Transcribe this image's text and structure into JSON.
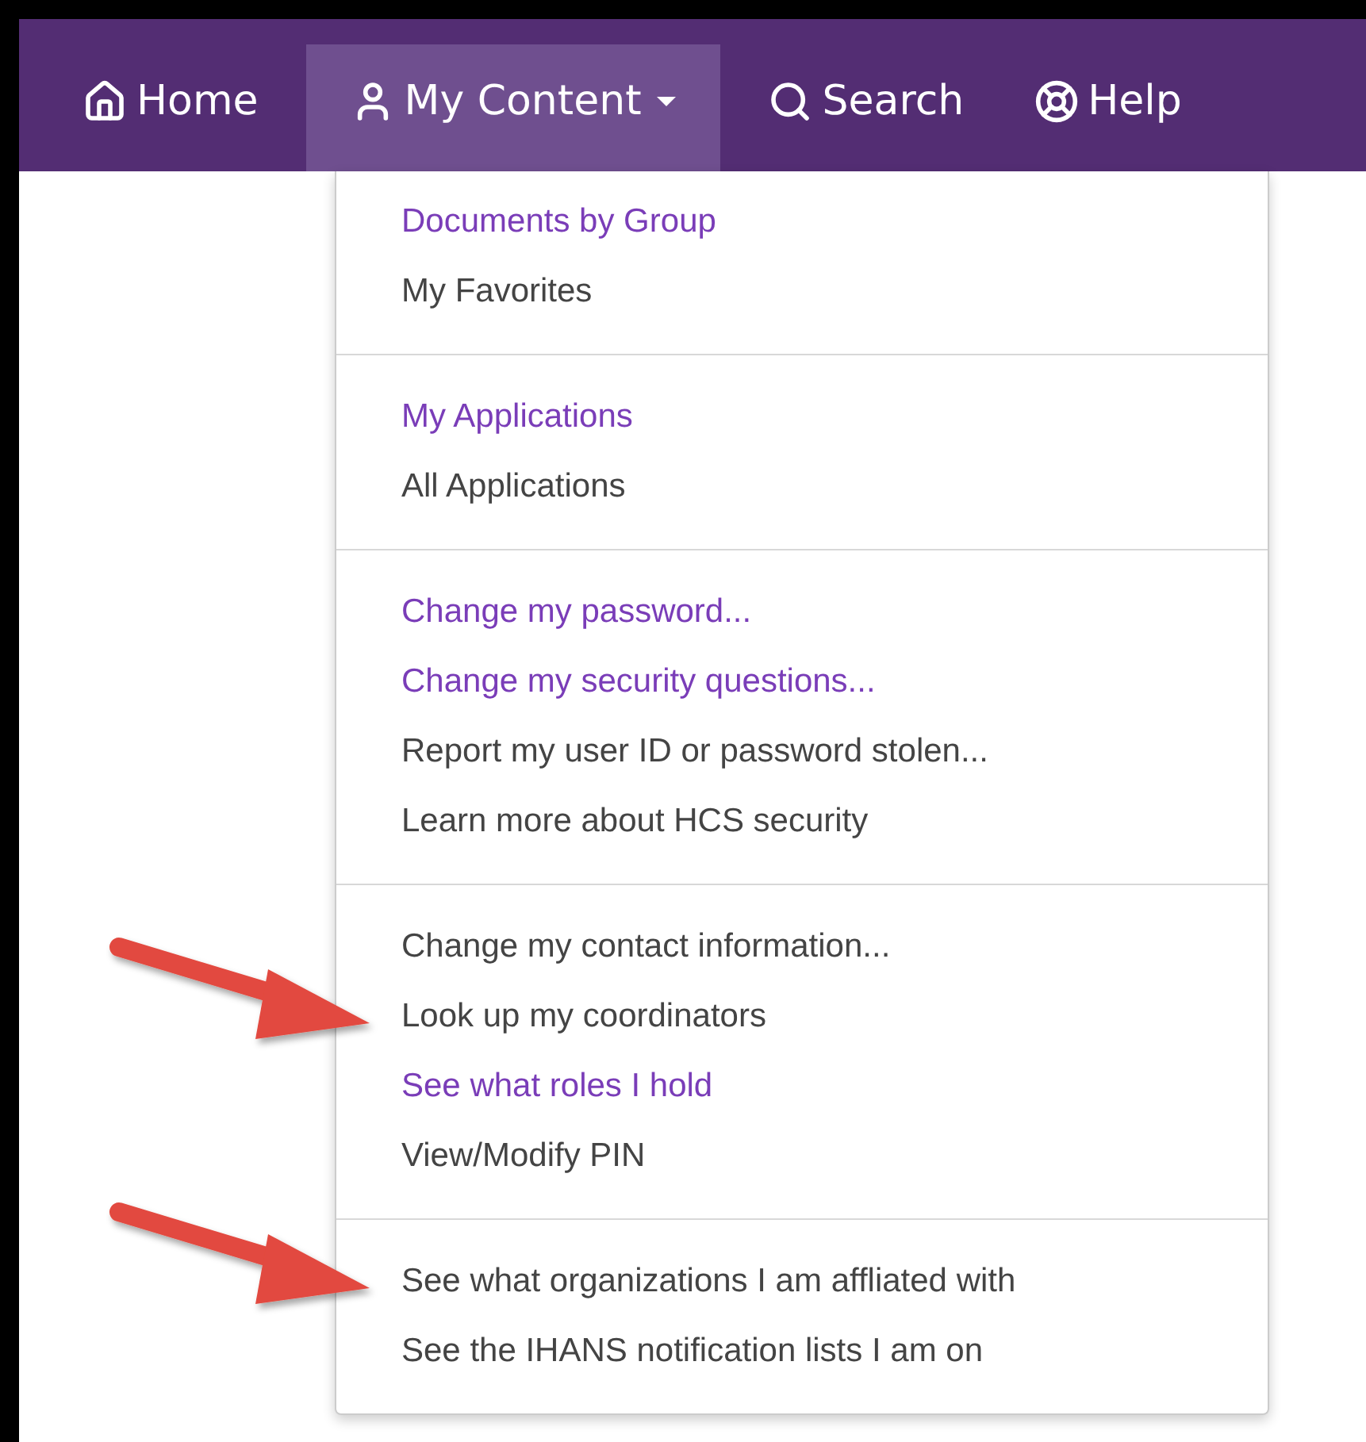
{
  "nav": {
    "items": [
      {
        "label": "Home",
        "selected": false,
        "dropdown": false
      },
      {
        "label": "My Content",
        "selected": true,
        "dropdown": true
      },
      {
        "label": "Search",
        "selected": false,
        "dropdown": false
      },
      {
        "label": "Help",
        "selected": false,
        "dropdown": false
      }
    ]
  },
  "menu": {
    "sections": [
      {
        "items": [
          {
            "label": "Documents by Group",
            "kind": "link",
            "pointed": false
          },
          {
            "label": "My Favorites",
            "kind": "text",
            "pointed": false
          }
        ]
      },
      {
        "items": [
          {
            "label": "My Applications",
            "kind": "link",
            "pointed": false
          },
          {
            "label": "All Applications",
            "kind": "text",
            "pointed": false
          }
        ]
      },
      {
        "items": [
          {
            "label": "Change my password...",
            "kind": "link",
            "pointed": false
          },
          {
            "label": "Change my security questions...",
            "kind": "link",
            "pointed": false
          },
          {
            "label": "Report my user ID or password stolen...",
            "kind": "text",
            "pointed": false
          },
          {
            "label": "Learn more about HCS security",
            "kind": "text",
            "pointed": false
          }
        ]
      },
      {
        "items": [
          {
            "label": "Change my contact information...",
            "kind": "text",
            "pointed": false
          },
          {
            "label": "Look up my coordinators",
            "kind": "text",
            "pointed": true
          },
          {
            "label": "See what roles I hold",
            "kind": "link",
            "pointed": false
          },
          {
            "label": "View/Modify PIN",
            "kind": "text",
            "pointed": false
          }
        ]
      },
      {
        "items": [
          {
            "label": "See what organizations I am affliated with",
            "kind": "text",
            "pointed": true
          },
          {
            "label": "See the IHANS notification lists I am on",
            "kind": "text",
            "pointed": false
          }
        ]
      }
    ]
  }
}
